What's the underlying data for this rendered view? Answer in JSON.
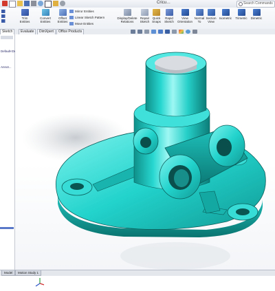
{
  "window": {
    "title": "Cricu…",
    "search_placeholder": "Search Commands"
  },
  "ribbon": {
    "left_tools": [
      {
        "label": "Trim\nEntities",
        "icon": "trim-icon"
      },
      {
        "label": "Convert\nEntities",
        "icon": "convert-icon"
      },
      {
        "label": "Offset\nEntities",
        "icon": "offset-icon"
      }
    ],
    "mirror_label": "Mirror Entities",
    "linear_pattern_label": "Linear Sketch Pattern",
    "move_label": "Move Entities",
    "display_relations_label": "Display/Delete\nRelations",
    "repair_sketch_label": "Repair\nSketch",
    "quick_snaps_label": "Quick\nSnaps",
    "rapid_sketch_label": "Rapid\nSketch",
    "view_buttons": [
      {
        "label": "View\nOrientation",
        "icon": "view-orientation-icon"
      },
      {
        "label": "Normal\nTo",
        "icon": "normal-to-icon"
      },
      {
        "label": "Section\nView",
        "icon": "section-view-icon"
      },
      {
        "label": "Isometric",
        "icon": "isometric-icon"
      },
      {
        "label": "Trimetric",
        "icon": "trimetric-icon"
      },
      {
        "label": "Dimetric",
        "icon": "dimetric-icon"
      }
    ]
  },
  "tabs": [
    {
      "label": "Sketch",
      "active": true
    },
    {
      "label": "Evaluate",
      "active": false
    },
    {
      "label": "DimXpert",
      "active": false
    },
    {
      "label": "Office Products",
      "active": false
    }
  ],
  "tree": {
    "item1": "Default<Default>_D...",
    "item2": "Annot..."
  },
  "status": {
    "model_tab": "Model",
    "motion_tab": "Motion Study 1"
  },
  "colors": {
    "part": "#22d3cc",
    "part_dark": "#12a49e",
    "part_shadow": "#0b6e6a",
    "ribbon_bg": "#eef1f5",
    "selection_blue": "#5a78c8"
  }
}
